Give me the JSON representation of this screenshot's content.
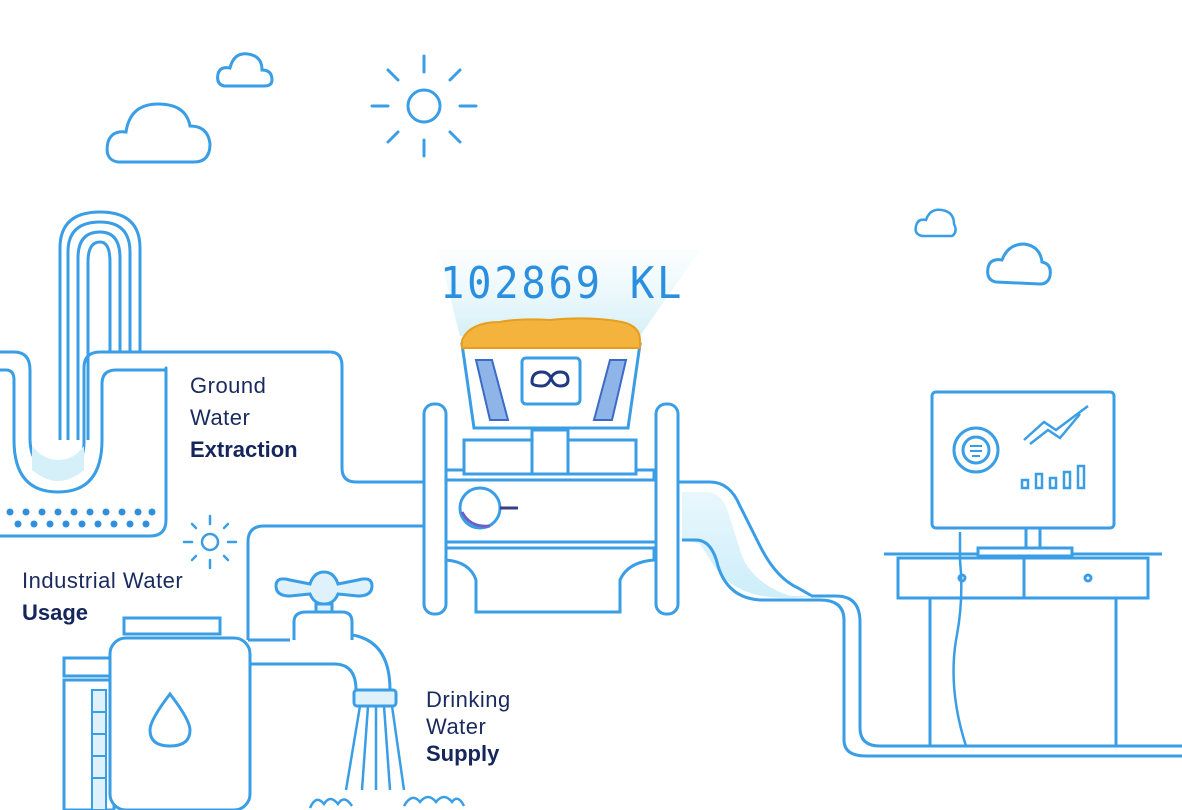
{
  "meter": {
    "reading": "102869 KL"
  },
  "labels": {
    "ground_water": {
      "line1": "Ground",
      "line2": "Water",
      "line3": "Extraction"
    },
    "industrial": {
      "line1": "Industrial Water",
      "line2": "Usage"
    },
    "drinking": {
      "line1": "Drinking",
      "line2": "Water",
      "line3": "Supply"
    }
  },
  "icons": [
    "cloud-icon",
    "sun-icon",
    "meter-icon",
    "tap-icon",
    "tank-icon",
    "water-drop-icon",
    "monitor-icon",
    "desk-icon",
    "gauge-icon",
    "line-chart-icon",
    "bar-chart-icon"
  ],
  "colors": {
    "line": "#3a9ee6",
    "fill": "#dff2fb",
    "accent": "#f3b33d",
    "text": "#1a2a5e"
  }
}
